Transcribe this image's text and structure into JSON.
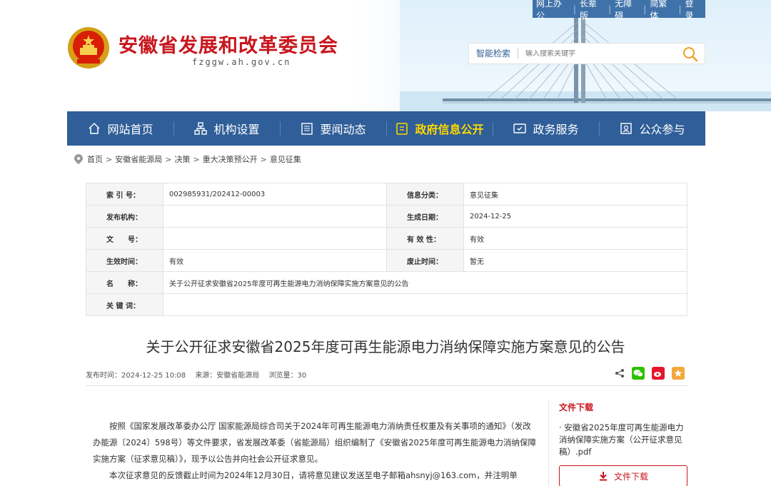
{
  "header": {
    "site_title": "安徽省发展和改革委员会",
    "site_domain": "fzggw.ah.gov.cn",
    "top_links": [
      "网上办公",
      "长辈版",
      "无障碍",
      "简繁体",
      "登录"
    ],
    "search_label": "智能检索",
    "search_placeholder": "输入搜索关键字"
  },
  "nav": [
    {
      "label": "网站首页",
      "icon": "home-icon"
    },
    {
      "label": "机构设置",
      "icon": "org-icon"
    },
    {
      "label": "要闻动态",
      "icon": "news-icon"
    },
    {
      "label": "政府信息公开",
      "icon": "info-icon",
      "active": true
    },
    {
      "label": "政务服务",
      "icon": "service-icon"
    },
    {
      "label": "公众参与",
      "icon": "participate-icon"
    }
  ],
  "breadcrumb": [
    "首页",
    "安徽省能源局",
    "决策",
    "重大决策预公开",
    "意见征集"
  ],
  "info": {
    "index_label": "索 引 号：",
    "index_value": "002985931/202412-00003",
    "category_label": "信息分类：",
    "category_value": "意见征集",
    "issuer_label": "发布机构：",
    "issuer_value": "",
    "date_label": "生成日期：",
    "date_value": "2024-12-25",
    "doc_label": "文　　号：",
    "doc_value": "",
    "validity_label": "有 效 性：",
    "validity_value": "有效",
    "effective_label": "生效时间：",
    "effective_value": "有效",
    "repeal_label": "废止时间：",
    "repeal_value": "暂无",
    "name_label": "名　　称：",
    "name_value": "关于公开征求安徽省2025年度可再生能源电力消纳保障实施方案意见的公告",
    "keywords_label": "关 键 词：",
    "keywords_value": ""
  },
  "article": {
    "title": "关于公开征求安徽省2025年度可再生能源电力消纳保障实施方案意见的公告",
    "publish_time": "发布时间：2024-12-25 10:08",
    "source": "来源：安徽省能源局",
    "views": "浏览量：30",
    "paragraph1": "按照《国家发展改革委办公厅 国家能源局综合司关于2024年可再生能源电力消纳责任权重及有关事项的通知》（发改办能源〔2024〕598号）等文件要求，省发展改革委（省能源局）组织编制了《安徽省2025年度可再生能源电力消纳保障实施方案（征求意见稿）》，现予以公告并向社会公开征求意见。",
    "paragraph2": "本次征求意见的反馈截止时间为2024年12月30日，请将意见建议发送至电子邮箱ahsnyj@163.com，并注明单"
  },
  "attachment": {
    "heading": "文件下载",
    "file": "· 安徽省2025年度可再生能源电力消纳保障实施方案（公开征求意见稿）.pdf",
    "button": "文件下载"
  },
  "colors": {
    "brand_red": "#c8161d",
    "nav_blue": "#2f5e98",
    "active_yellow": "#ffd900"
  }
}
